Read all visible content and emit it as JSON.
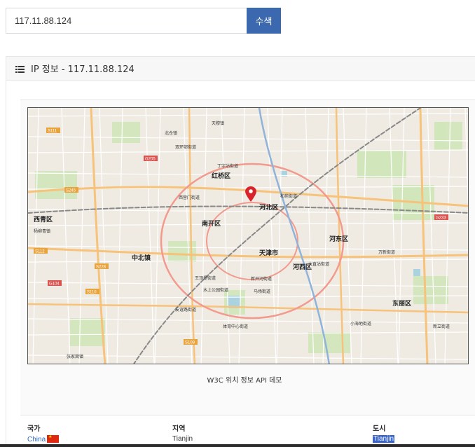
{
  "search": {
    "value": "117.11.88.124",
    "button_label": "수색"
  },
  "panel": {
    "heading": "IP 정보 - 117.11.88.124",
    "icon": "list-icon"
  },
  "map": {
    "caption": "W3C 위치 정보 API 데모",
    "marker_icon": "map-pin-icon",
    "districts": [
      "红桥区",
      "河北区",
      "南开区",
      "河东区",
      "天津市",
      "河西区",
      "西青区",
      "东丽区",
      "中北镇"
    ],
    "labels": [
      "天穆镇",
      "北仓镇",
      "双环邨街道",
      "丁字沽街道",
      "和苑街道",
      "西营门街道",
      "王顶堤街道",
      "水上公园街道",
      "体育中心街道",
      "友谊路街道",
      "大直沽街道",
      "新开河街道",
      "万新街道",
      "张家窝镇",
      "杨柳青镇",
      "新立街道",
      "马场街道",
      "小海地街道"
    ],
    "road_badges": [
      "S111",
      "G205",
      "S245",
      "S228",
      "G104",
      "S110",
      "S109",
      "G233",
      "S112"
    ]
  },
  "table": {
    "headers": [
      "국가",
      "지역",
      "도시"
    ],
    "country": "China",
    "region": "Tianjin",
    "city": "Tianjin"
  },
  "colors": {
    "primary": "#3c68b0",
    "link": "#2d6cc0",
    "selection": "#3a64c8",
    "marker": "#d8232a"
  }
}
